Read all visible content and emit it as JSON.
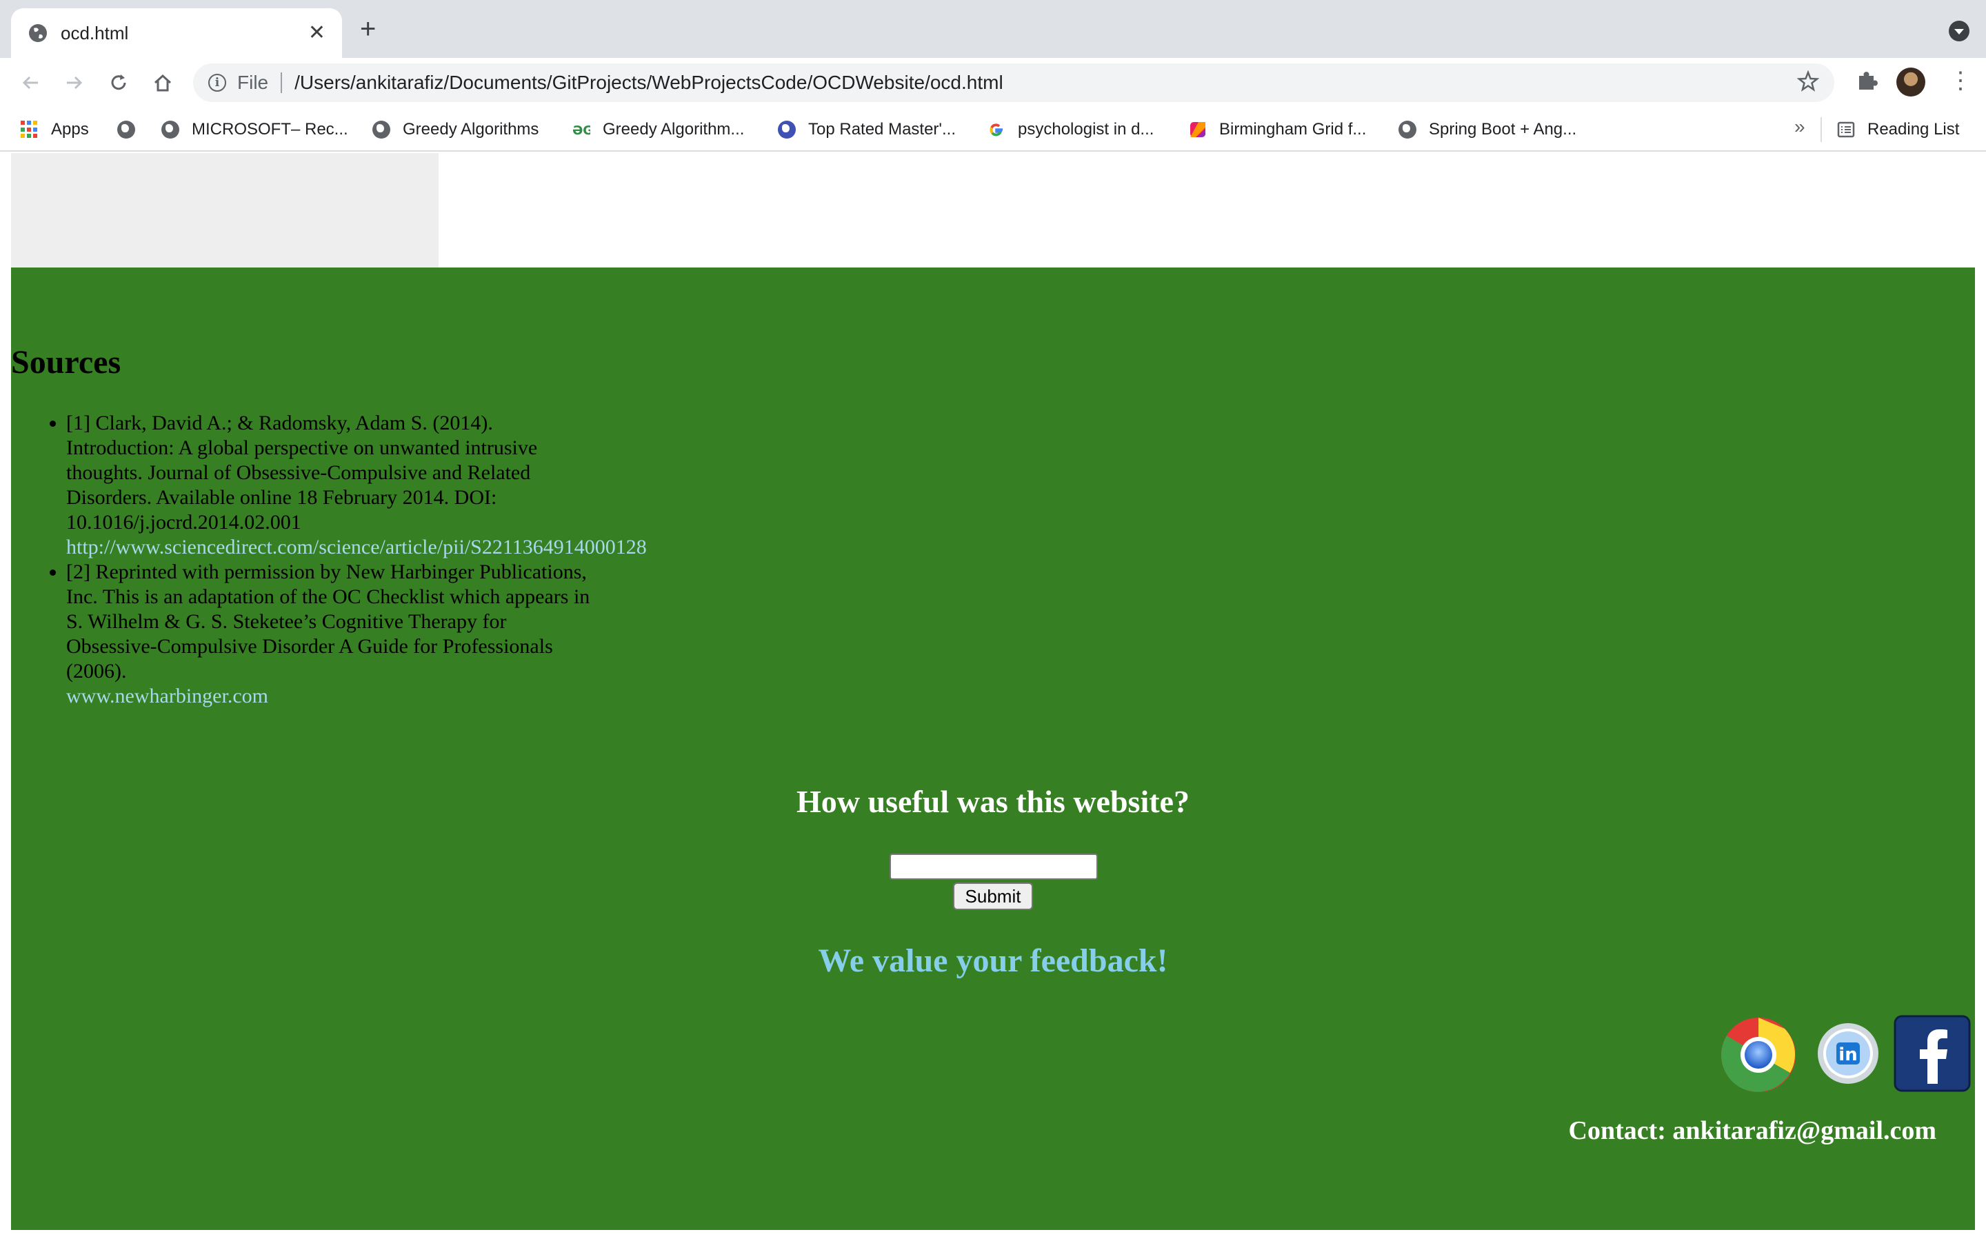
{
  "browser": {
    "tab_title": "ocd.html",
    "new_tab": "+",
    "close_glyph": "✕",
    "address_scheme": "File",
    "address_url": "/Users/ankitarafiz/Documents/GitProjects/WebProjectsCode/OCDWebsite/ocd.html",
    "bookmarks": [
      {
        "label": "Apps",
        "icon": "apps-grid-icon"
      },
      {
        "label": "",
        "icon": "globe-icon"
      },
      {
        "label": "MICROSOFT– Rec...",
        "icon": "globe-icon"
      },
      {
        "label": "Greedy Algorithms",
        "icon": "globe-icon"
      },
      {
        "label": "Greedy Algorithm...",
        "icon": "geeksforgeeks-icon"
      },
      {
        "label": "Top Rated Master'...",
        "icon": "globe-icon"
      },
      {
        "label": "psychologist in d...",
        "icon": "google-icon"
      },
      {
        "label": "Birmingham Grid f...",
        "icon": "colorful-icon"
      },
      {
        "label": "Spring Boot + Ang...",
        "icon": "globe-icon"
      }
    ],
    "bookmarks_overflow": "»",
    "reading_list": "Reading List"
  },
  "page": {
    "sources_heading": "Sources",
    "sources": [
      {
        "text": "[1] Clark, David A.; & Radomsky, Adam S. (2014). Introduction: A global perspective on unwanted intrusive thoughts. Journal of Obsessive-Compulsive and Related Disorders. Available online 18 February 2014. DOI: 10.1016/j.jocrd.2014.02.001",
        "link": "http://www.sciencedirect.com/science/article/pii/S2211364914000128"
      },
      {
        "text": "[2] Reprinted with permission by New Harbinger Publications, Inc. This is an adaptation of the OC Checklist which appears in S. Wilhelm & G. S. Steketee’s Cognitive Therapy for Obsessive-Compulsive Disorder A Guide for Professionals (2006).",
        "link": "www.newharbinger.com"
      }
    ],
    "feedback_heading": "How useful was this website?",
    "feedback_input_value": "",
    "submit_label": "Submit",
    "value_heading": "We value your feedback!",
    "social_icons": [
      "chrome-icon",
      "linkedin-icon",
      "facebook-icon"
    ],
    "contact": "Contact: ankitarafiz@gmail.com"
  },
  "colors": {
    "footer_green": "#367f22",
    "link_blue": "#a8d8ea",
    "value_heading_blue": "#87ceeb",
    "tabstrip": "#dee1e6"
  }
}
